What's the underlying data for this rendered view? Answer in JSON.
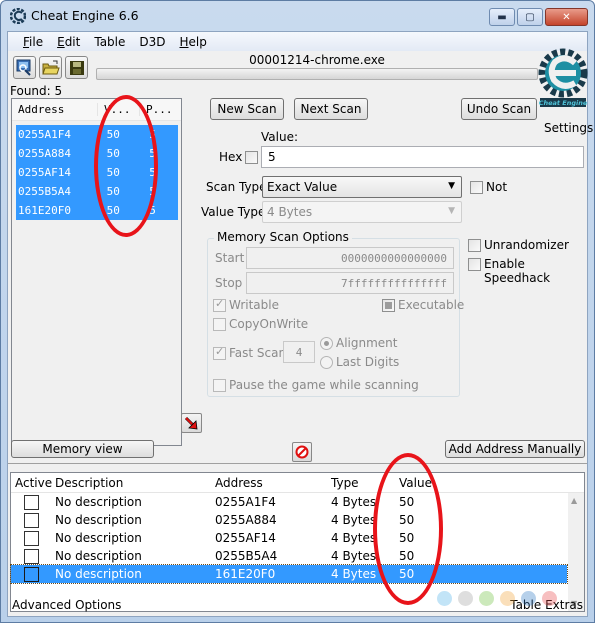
{
  "window": {
    "title": "Cheat Engine 6.6",
    "controls": [
      "minimize",
      "maximize",
      "close"
    ]
  },
  "menu": [
    {
      "label": "File",
      "mnemonic": "F",
      "rest": "ile"
    },
    {
      "label": "Edit",
      "mnemonic": "E",
      "rest": "dit"
    },
    {
      "label": "Table",
      "mnemonic": "",
      "rest": "Table"
    },
    {
      "label": "D3D",
      "mnemonic": "",
      "rest": "D3D"
    },
    {
      "label": "Help",
      "mnemonic": "H",
      "rest": "elp"
    }
  ],
  "toolbar": {
    "buttons": [
      "open-process-icon",
      "open-file-icon",
      "save-icon"
    ]
  },
  "process": {
    "name": "00001214-chrome.exe",
    "progress_percent": 0
  },
  "logo": {
    "caption": "Cheat Engine",
    "settings_label": "Settings"
  },
  "found": {
    "label": "Found: 5"
  },
  "results": {
    "columns": [
      "Address",
      "V...",
      "P..."
    ],
    "rows": [
      {
        "address": "0255A1F4",
        "value": "50",
        "previous": "5"
      },
      {
        "address": "0255A884",
        "value": "50",
        "previous": "5"
      },
      {
        "address": "0255AF14",
        "value": "50",
        "previous": "5"
      },
      {
        "address": "0255B5A4",
        "value": "50",
        "previous": "5"
      },
      {
        "address": "161E20F0",
        "value": "50",
        "previous": "5"
      }
    ]
  },
  "scan": {
    "new_scan": "New Scan",
    "next_scan": "Next Scan",
    "undo_scan": "Undo Scan",
    "value_label": "Value:",
    "hex_label": "Hex",
    "hex_checked": false,
    "value": "5",
    "scan_type_label": "Scan Type",
    "scan_type": "Exact Value",
    "not_label": "Not",
    "not_checked": false,
    "value_type_label": "Value Type",
    "value_type": "4 Bytes"
  },
  "memory_options": {
    "title": "Memory Scan Options",
    "start_label": "Start",
    "start": "0000000000000000",
    "stop_label": "Stop",
    "stop": "7fffffffffffffff",
    "writable_label": "Writable",
    "writable": true,
    "executable_label": "Executable",
    "executable": "indeterminate",
    "copyonwrite_label": "CopyOnWrite",
    "copyonwrite": false,
    "fastscan_label": "Fast Scan",
    "fastscan": true,
    "fastscan_value": "4",
    "alignment_label": "Alignment",
    "lastdigits_label": "Last Digits",
    "alignment_selected": true,
    "pause_label": "Pause the game while scanning",
    "pause": false
  },
  "extras": {
    "unrandomizer_label": "Unrandomizer",
    "unrandomizer": false,
    "speedhack_label": "Enable Speedhack",
    "speedhack": false
  },
  "actions": {
    "memory_view": "Memory view",
    "add_address": "Add Address Manually"
  },
  "address_table": {
    "columns": [
      "Active",
      "Description",
      "Address",
      "Type",
      "Value"
    ],
    "rows": [
      {
        "active": false,
        "description": "No description",
        "address": "0255A1F4",
        "type": "4 Bytes",
        "value": "50",
        "selected": false
      },
      {
        "active": false,
        "description": "No description",
        "address": "0255A884",
        "type": "4 Bytes",
        "value": "50",
        "selected": false
      },
      {
        "active": false,
        "description": "No description",
        "address": "0255AF14",
        "type": "4 Bytes",
        "value": "50",
        "selected": false
      },
      {
        "active": false,
        "description": "No description",
        "address": "0255B5A4",
        "type": "4 Bytes",
        "value": "50",
        "selected": false
      },
      {
        "active": false,
        "description": "No description",
        "address": "161E20F0",
        "type": "4 Bytes",
        "value": "50",
        "selected": true
      }
    ]
  },
  "footer": {
    "advanced_options": "Advanced Options",
    "table_extras": "Table Extras"
  },
  "colors": {
    "selection": "#3399ff",
    "annotation": "#e8141a",
    "logo": "#1e8fa3"
  },
  "watermark_colors": [
    "#4fb3e8",
    "#a0a0a0",
    "#6cbf3c",
    "#f2a23a",
    "#2f79c4",
    "#e8484a"
  ]
}
